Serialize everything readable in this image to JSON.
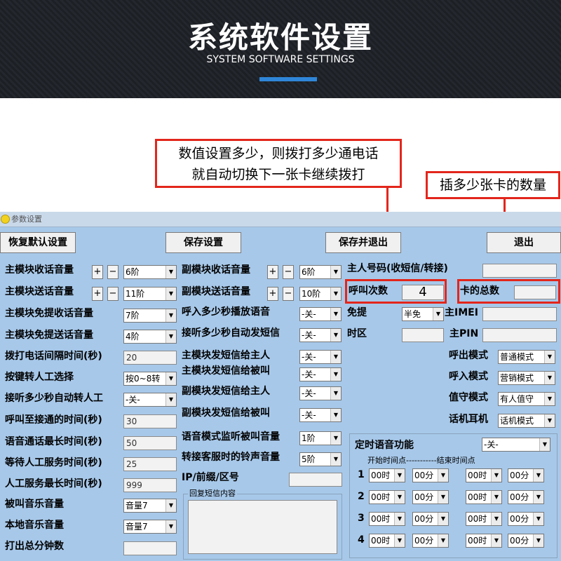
{
  "banner": {
    "title": "系统软件设置",
    "subtitle": "SYSTEM SOFTWARE SETTINGS"
  },
  "callouts": {
    "call_count_note_l1": "数值设置多少，则拨打多少通电话",
    "call_count_note_l2": "就自动切换下一张卡继续拨打",
    "card_count_note": "插多少张卡的数量"
  },
  "window": {
    "title": "参数设置"
  },
  "buttons": {
    "restore": "恢复默认设置",
    "save": "保存设置",
    "save_exit": "保存并退出",
    "exit": "退出",
    "plus": "+",
    "minus": "−"
  },
  "left": [
    {
      "label": "主模块收话音量",
      "value": "6阶"
    },
    {
      "label": "主模块送话音量",
      "value": "11阶"
    },
    {
      "label": "主模块免提收话音量",
      "value": "7阶"
    },
    {
      "label": "主模块免提送话音量",
      "value": "4阶"
    },
    {
      "label": "拨打电话间隔时间(秒)",
      "value": "20"
    },
    {
      "label": "按键转人工选择",
      "value": "按0~8转"
    },
    {
      "label": "接听多少秒自动转人工",
      "value": "-关-"
    },
    {
      "label": "呼叫至接通的时间(秒)",
      "value": "30"
    },
    {
      "label": "语音通话最长时间(秒)",
      "value": "50"
    },
    {
      "label": "等待人工服务时间(秒)",
      "value": "25"
    },
    {
      "label": "人工服务最长时间(秒)",
      "value": "999"
    },
    {
      "label": "被叫音乐音量",
      "value": "音量7"
    },
    {
      "label": "本地音乐音量",
      "value": "音量7"
    },
    {
      "label": "打出总分钟数",
      "value": ""
    }
  ],
  "middle": [
    {
      "label": "副模块收话音量",
      "value": "6阶"
    },
    {
      "label": "副模块送话音量",
      "value": "10阶"
    },
    {
      "label": "呼入多少秒播放语音",
      "value": "-关-"
    },
    {
      "label": "接听多少秒自动发短信",
      "value": "-关-"
    },
    {
      "label": "主模块发短信给主人",
      "value": "-关-"
    },
    {
      "label": "主模块发短信给被叫",
      "value": "-关-"
    },
    {
      "label": "副模块发短信给主人",
      "value": "-关-"
    },
    {
      "label": "副模块发短信给被叫",
      "value": "-关-"
    },
    {
      "label": "语音模式监听被叫音量",
      "value": "1阶"
    },
    {
      "label": "转接客服时的铃声音量",
      "value": "5阶"
    },
    {
      "label": "IP/前缀/区号",
      "value": ""
    }
  ],
  "reply_sms": {
    "label": "回复短信内容"
  },
  "right": {
    "owner_number_label": "主人号码(收短信/转接)",
    "owner_number": "",
    "call_count_label": "呼叫次数",
    "call_count": "4",
    "card_total_label": "卡的总数",
    "card_total": "",
    "handsfree_label": "免提",
    "handsfree": "半免",
    "imei_label": "主IMEI",
    "imei": "",
    "timezone_label": "时区",
    "timezone": "",
    "pin_label": "主PIN",
    "pin": "",
    "outgoing_mode_label": "呼出模式",
    "outgoing_mode": "普通模式",
    "incoming_mode_label": "呼入模式",
    "incoming_mode": "营销模式",
    "duty_mode_label": "值守模式",
    "duty_mode": "有人值守",
    "earphone_label": "话机耳机",
    "earphone": "话机模式"
  },
  "timer": {
    "title": "定时语音功能",
    "enabled": "-关-",
    "header": "开始时间点-----------结束时间点",
    "rows": [
      {
        "index": "1",
        "start_h": "00时",
        "start_m": "00分",
        "end_h": "00时",
        "end_m": "00分"
      },
      {
        "index": "2",
        "start_h": "00时",
        "start_m": "00分",
        "end_h": "00时",
        "end_m": "00分"
      },
      {
        "index": "3",
        "start_h": "00时",
        "start_m": "00分",
        "end_h": "00时",
        "end_m": "00分"
      },
      {
        "index": "4",
        "start_h": "00时",
        "start_m": "00分",
        "end_h": "00时",
        "end_m": "00分"
      }
    ]
  }
}
